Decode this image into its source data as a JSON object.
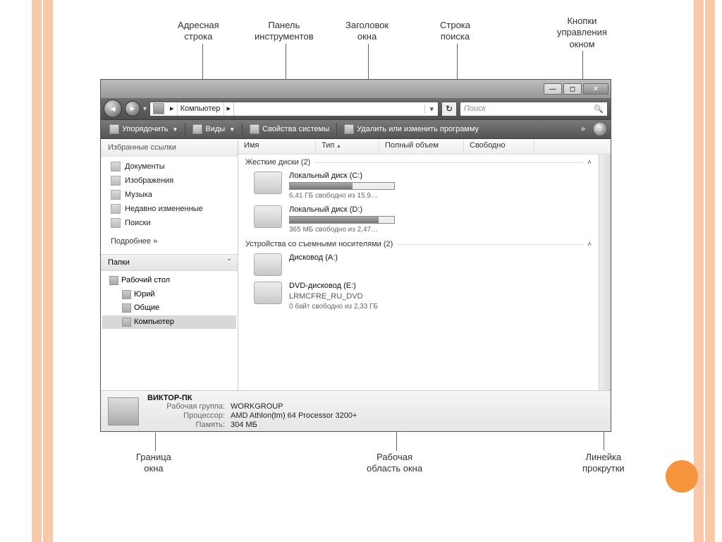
{
  "labels": {
    "address_bar": "Адресная\nстрока",
    "toolbar_panel": "Панель\nинструментов",
    "window_title": "Заголовок\nокна",
    "search_bar": "Строка\nпоиска",
    "window_controls": "Кнопки\nуправления\nокном",
    "window_border": "Граница\nокна",
    "work_area": "Рабочая\nобласть окна",
    "scrollbar": "Линейка\nпрокрутки"
  },
  "nav": {
    "breadcrumb_root": "Компьютер",
    "breadcrumb_sep": "▸",
    "search_placeholder": "Поиск"
  },
  "toolbar": {
    "organize": "Упорядочить",
    "views": "Виды",
    "sysprops": "Свойства системы",
    "uninstall": "Удалить или изменить программу",
    "more": "»",
    "help": "?"
  },
  "sidebar": {
    "fav_header": "Избранные ссылки",
    "items": [
      {
        "label": "Документы"
      },
      {
        "label": "Изображения"
      },
      {
        "label": "Музыка"
      },
      {
        "label": "Недавно измененные"
      },
      {
        "label": "Поиски"
      }
    ],
    "more": "Подробнее  »",
    "folders_header": "Папки",
    "folders_caret": "ˇ",
    "tree": {
      "n0": "Рабочий стол",
      "n1": "Юрий",
      "n2": "Общие",
      "n3": "Компьютер"
    }
  },
  "columns": {
    "name": "Имя",
    "type": "Тип",
    "total": "Полный объем",
    "free": "Свободно"
  },
  "groups": {
    "hdd": "Жесткие диски (2)",
    "removable": "Устройства со съемными носителями (2)"
  },
  "drives": {
    "c": {
      "name": "Локальный диск (C:)",
      "free": "6,41 ГБ свободно из 15,9…",
      "fill": 60
    },
    "d": {
      "name": "Локальный диск (D:)",
      "free": "365 МБ свободно из 2,47…",
      "fill": 85
    },
    "a": {
      "name": "Дисковод (A:)"
    },
    "e": {
      "name": "DVD-дисковод (E:)",
      "label": "LRMCFRE_RU_DVD",
      "free": "0 байт свободно из 2,33 ГБ"
    }
  },
  "details": {
    "computer": "ВИКТОР-ПК",
    "workgroup_k": "Рабочая группа:",
    "workgroup_v": "WORKGROUP",
    "cpu_k": "Процессор:",
    "cpu_v": "AMD Athlon(tm) 64 Processor 3200+",
    "mem_k": "Память:",
    "mem_v": "304 МБ"
  }
}
